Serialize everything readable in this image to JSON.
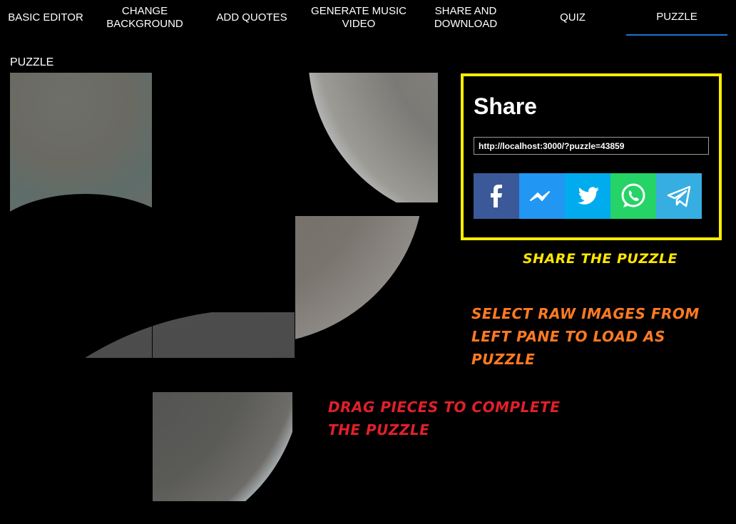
{
  "tabs": [
    {
      "label": "BASIC EDITOR",
      "active": false
    },
    {
      "label": "CHANGE BACKGROUND",
      "active": false
    },
    {
      "label": "ADD QUOTES",
      "active": false
    },
    {
      "label": "GENERATE MUSIC VIDEO",
      "active": false
    },
    {
      "label": "SHARE AND DOWNLOAD",
      "active": false
    },
    {
      "label": "QUIZ",
      "active": false
    },
    {
      "label": "PUZZLE",
      "active": true
    }
  ],
  "section_title": "PUZZLE",
  "share": {
    "title": "Share",
    "url": "http://localhost:3000/?puzzle=43859",
    "buttons": [
      {
        "name": "facebook",
        "icon": "facebook-icon",
        "color": "#3b5998"
      },
      {
        "name": "messenger",
        "icon": "messenger-icon",
        "color": "#2196f3"
      },
      {
        "name": "twitter",
        "icon": "twitter-icon",
        "color": "#00aced"
      },
      {
        "name": "whatsapp",
        "icon": "whatsapp-icon",
        "color": "#25d366"
      },
      {
        "name": "telegram",
        "icon": "telegram-icon",
        "color": "#37aee2"
      }
    ],
    "border_color": "#ffee00"
  },
  "hints": {
    "share": "SHARE THE PUZZLE",
    "select": "SELECT RAW IMAGES FROM LEFT PANE TO LOAD AS PUZZLE",
    "drag": "DRAG PIECES TO COMPLETE THE PUZZLE"
  },
  "colors": {
    "active_tab_underline": "#1976d2",
    "hint_share": "#ffe600",
    "hint_select": "#ff7a22",
    "hint_drag": "#e0202a"
  }
}
